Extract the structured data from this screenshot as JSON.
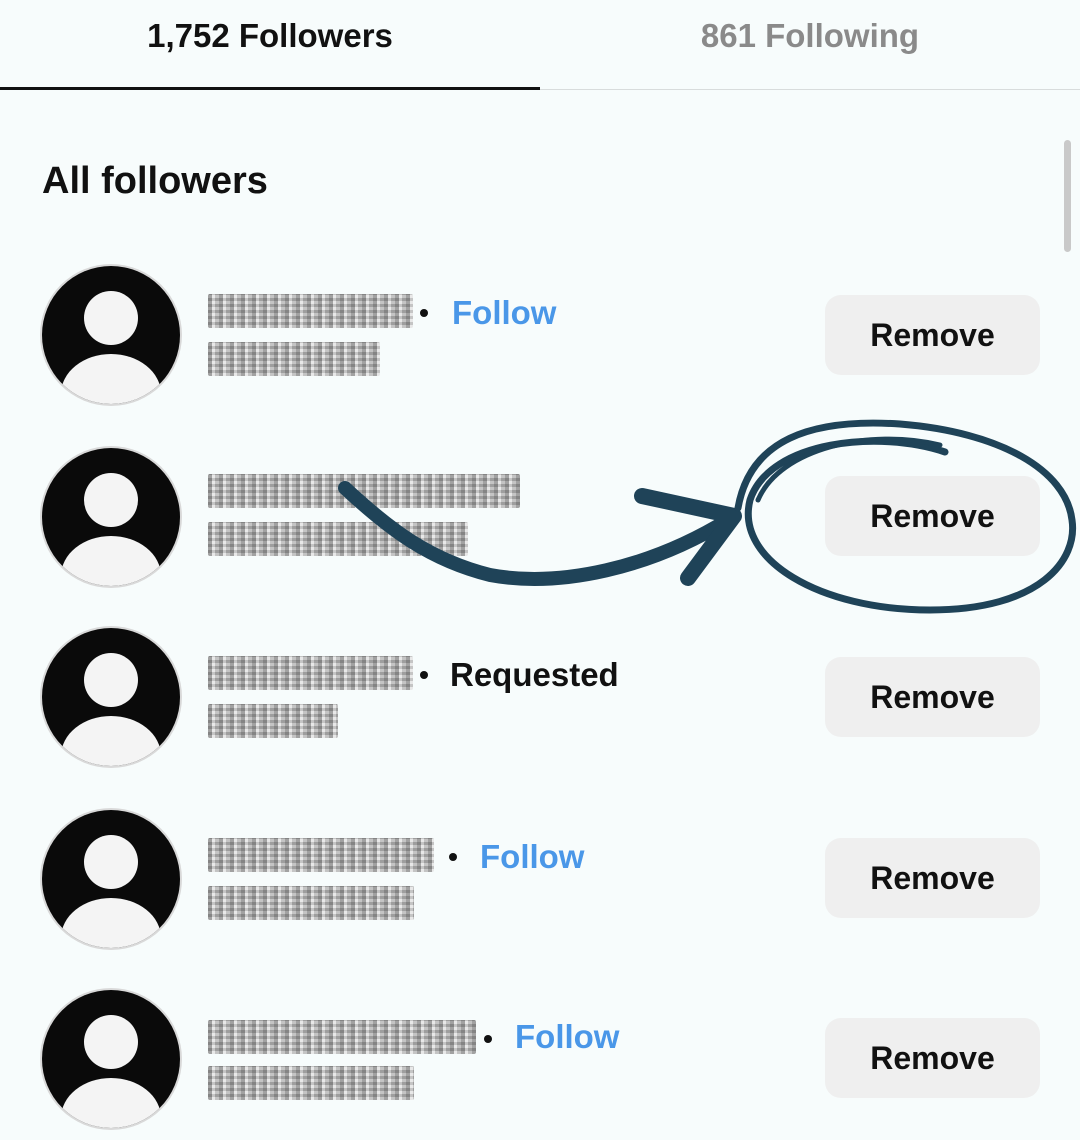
{
  "tabs": {
    "followers_label": "1,752 Followers",
    "following_label": "861 Following"
  },
  "section_title": "All followers",
  "followers": [
    {
      "status": "Follow",
      "status_type": "follow",
      "remove_label": "Remove"
    },
    {
      "status": "",
      "status_type": "none",
      "remove_label": "Remove"
    },
    {
      "status": "Requested",
      "status_type": "requested",
      "remove_label": "Remove"
    },
    {
      "status": "Follow",
      "status_type": "follow",
      "remove_label": "Remove"
    },
    {
      "status": "Follow",
      "status_type": "follow",
      "remove_label": "Remove"
    }
  ],
  "colors": {
    "accent_blue": "#4a97e8",
    "annotation_navy": "#1f4358",
    "button_bg": "#efefef",
    "background": "#f7fcfc"
  },
  "icons": {
    "avatar": "default-profile-silhouette-icon",
    "annotation": "hand-drawn-arrow-and-circle"
  }
}
